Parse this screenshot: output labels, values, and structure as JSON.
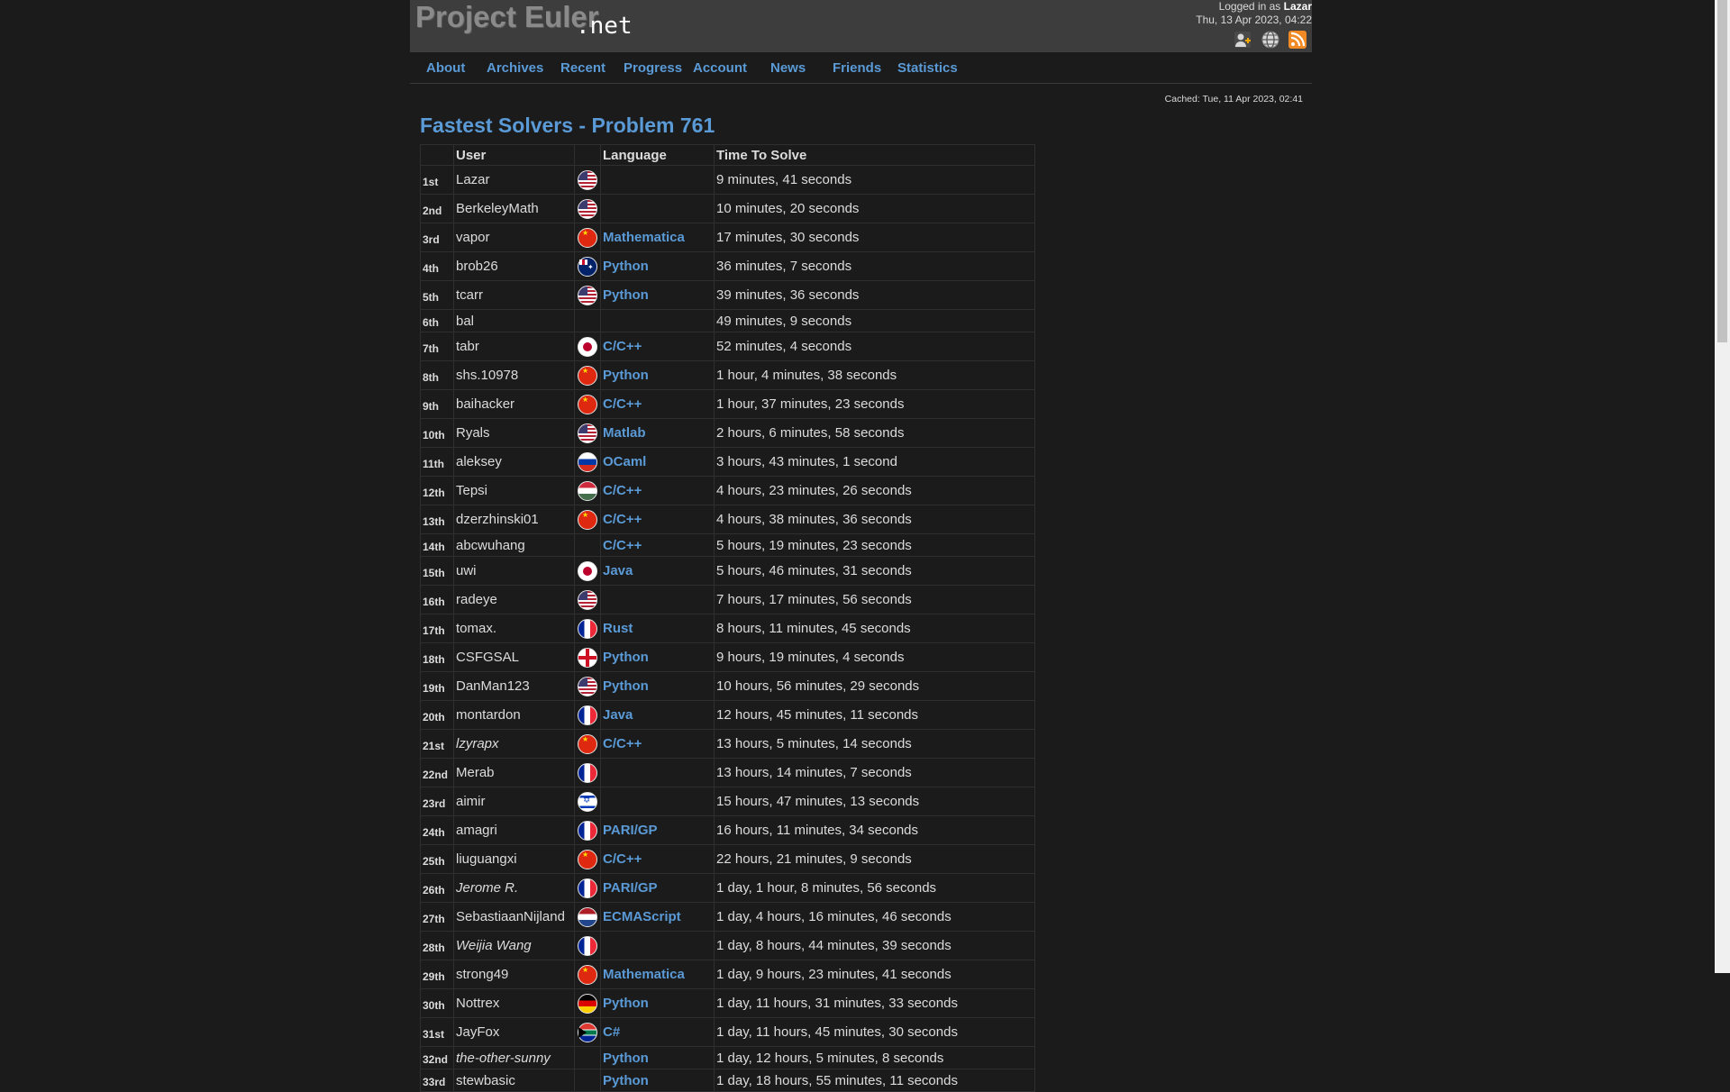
{
  "header": {
    "logo_main": "Project Euler",
    "logo_suffix": ".net",
    "logged_prefix": "Logged in as",
    "user": "Lazar",
    "datetime": "Thu, 13 Apr 2023, 04:22",
    "icons": [
      "account-icon",
      "globe-icon",
      "rss-icon"
    ]
  },
  "nav": [
    "About",
    "Archives",
    "Recent",
    "Progress",
    "Account",
    "News",
    "Friends",
    "Statistics"
  ],
  "cached": "Cached: Tue, 11 Apr 2023, 02:41",
  "title": "Fastest Solvers - Problem 761",
  "columns": {
    "rank": "",
    "user": "User",
    "flag": "",
    "language": "Language",
    "time": "Time To Solve"
  },
  "rows": [
    {
      "rank": "1st",
      "user": "Lazar",
      "flag": "us",
      "language": "",
      "time": "9 minutes, 41 seconds"
    },
    {
      "rank": "2nd",
      "user": "BerkeleyMath",
      "flag": "us",
      "language": "",
      "time": "10 minutes, 20 seconds"
    },
    {
      "rank": "3rd",
      "user": "vapor",
      "flag": "cn",
      "language": "Mathematica",
      "time": "17 minutes, 30 seconds"
    },
    {
      "rank": "4th",
      "user": "brob26",
      "flag": "au",
      "language": "Python",
      "time": "36 minutes, 7 seconds"
    },
    {
      "rank": "5th",
      "user": "tcarr",
      "flag": "us",
      "language": "Python",
      "time": "39 minutes, 36 seconds"
    },
    {
      "rank": "6th",
      "user": "bal",
      "flag": "",
      "language": "",
      "time": "49 minutes, 9 seconds"
    },
    {
      "rank": "7th",
      "user": "tabr",
      "flag": "jp",
      "language": "C/C++",
      "time": "52 minutes, 4 seconds"
    },
    {
      "rank": "8th",
      "user": "shs.10978",
      "flag": "cn",
      "language": "Python",
      "time": "1 hour, 4 minutes, 38 seconds"
    },
    {
      "rank": "9th",
      "user": "baihacker",
      "flag": "cn",
      "language": "C/C++",
      "time": "1 hour, 37 minutes, 23 seconds"
    },
    {
      "rank": "10th",
      "user": "Ryals",
      "flag": "us",
      "language": "Matlab",
      "time": "2 hours, 6 minutes, 58 seconds"
    },
    {
      "rank": "11th",
      "user": "aleksey",
      "flag": "ru",
      "language": "OCaml",
      "time": "3 hours, 43 minutes, 1 second"
    },
    {
      "rank": "12th",
      "user": "Tepsi",
      "flag": "hu",
      "language": "C/C++",
      "time": "4 hours, 23 minutes, 26 seconds"
    },
    {
      "rank": "13th",
      "user": "dzerzhinski01",
      "flag": "cn",
      "language": "C/C++",
      "time": "4 hours, 38 minutes, 36 seconds"
    },
    {
      "rank": "14th",
      "user": "abcwuhang",
      "flag": "",
      "language": "C/C++",
      "time": "5 hours, 19 minutes, 23 seconds"
    },
    {
      "rank": "15th",
      "user": "uwi",
      "flag": "jp",
      "language": "Java",
      "time": "5 hours, 46 minutes, 31 seconds"
    },
    {
      "rank": "16th",
      "user": "radeye",
      "flag": "us",
      "language": "",
      "time": "7 hours, 17 minutes, 56 seconds"
    },
    {
      "rank": "17th",
      "user": "tomax.",
      "flag": "fr",
      "language": "Rust",
      "time": "8 hours, 11 minutes, 45 seconds"
    },
    {
      "rank": "18th",
      "user": "CSFGSAL",
      "flag": "en",
      "language": "Python",
      "time": "9 hours, 19 minutes, 4 seconds"
    },
    {
      "rank": "19th",
      "user": "DanMan123",
      "flag": "us",
      "language": "Python",
      "time": "10 hours, 56 minutes, 29 seconds"
    },
    {
      "rank": "20th",
      "user": "montardon",
      "flag": "fr",
      "language": "Java",
      "time": "12 hours, 45 minutes, 11 seconds"
    },
    {
      "rank": "21st",
      "user": "lzyrapx",
      "flag": "cn",
      "language": "C/C++",
      "time": "13 hours, 5 minutes, 14 seconds",
      "italic": true
    },
    {
      "rank": "22nd",
      "user": "Merab",
      "flag": "fr",
      "language": "",
      "time": "13 hours, 14 minutes, 7 seconds"
    },
    {
      "rank": "23rd",
      "user": "aimir",
      "flag": "il",
      "language": "",
      "time": "15 hours, 47 minutes, 13 seconds"
    },
    {
      "rank": "24th",
      "user": "amagri",
      "flag": "fr",
      "language": "PARI/GP",
      "time": "16 hours, 11 minutes, 34 seconds"
    },
    {
      "rank": "25th",
      "user": "liuguangxi",
      "flag": "cn",
      "language": "C/C++",
      "time": "22 hours, 21 minutes, 9 seconds"
    },
    {
      "rank": "26th",
      "user": "Jerome R.",
      "flag": "fr",
      "language": "PARI/GP",
      "time": "1 day, 1 hour, 8 minutes, 56 seconds",
      "italic": true
    },
    {
      "rank": "27th",
      "user": "SebastiaanNijland",
      "flag": "nl",
      "language": "ECMAScript",
      "time": "1 day, 4 hours, 16 minutes, 46 seconds"
    },
    {
      "rank": "28th",
      "user": "Weijia Wang",
      "flag": "fr",
      "language": "",
      "time": "1 day, 8 hours, 44 minutes, 39 seconds",
      "italic": true
    },
    {
      "rank": "29th",
      "user": "strong49",
      "flag": "cn",
      "language": "Mathematica",
      "time": "1 day, 9 hours, 23 minutes, 41 seconds"
    },
    {
      "rank": "30th",
      "user": "Nottrex",
      "flag": "de",
      "language": "Python",
      "time": "1 day, 11 hours, 31 minutes, 33 seconds"
    },
    {
      "rank": "31st",
      "user": "JayFox",
      "flag": "za",
      "language": "C#",
      "time": "1 day, 11 hours, 45 minutes, 30 seconds"
    },
    {
      "rank": "32nd",
      "user": "the-other-sunny",
      "flag": "",
      "language": "Python",
      "time": "1 day, 12 hours, 5 minutes, 8 seconds",
      "italic": true
    },
    {
      "rank": "33rd",
      "user": "stewbasic",
      "flag": "",
      "language": "Python",
      "time": "1 day, 18 hours, 55 minutes, 11 seconds"
    }
  ]
}
